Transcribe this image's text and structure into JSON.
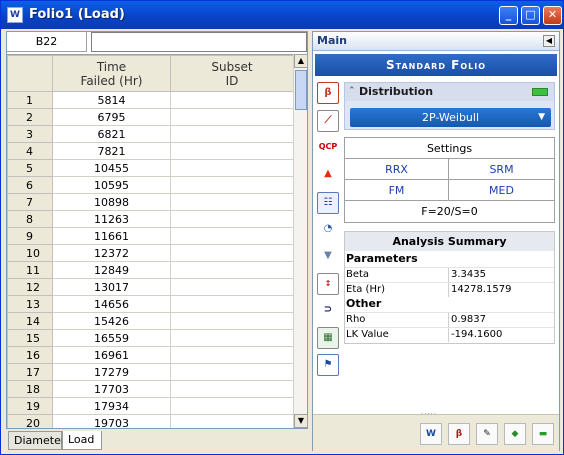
{
  "window": {
    "title": "Folio1 (Load)",
    "minimize": "_",
    "maximize": "□",
    "close": "✕"
  },
  "grid": {
    "cell_ref": "B22",
    "formula_value": "",
    "columns": [
      "Time\nFailed (Hr)",
      "Subset\nID"
    ],
    "col1_line1": "Time",
    "col1_line2": "Failed (Hr)",
    "col2_line1": "Subset",
    "col2_line2": "ID",
    "rows": [
      {
        "n": "1",
        "time": "5814",
        "subset": ""
      },
      {
        "n": "2",
        "time": "6795",
        "subset": ""
      },
      {
        "n": "3",
        "time": "6821",
        "subset": ""
      },
      {
        "n": "4",
        "time": "7821",
        "subset": ""
      },
      {
        "n": "5",
        "time": "10455",
        "subset": ""
      },
      {
        "n": "6",
        "time": "10595",
        "subset": ""
      },
      {
        "n": "7",
        "time": "10898",
        "subset": ""
      },
      {
        "n": "8",
        "time": "11263",
        "subset": ""
      },
      {
        "n": "9",
        "time": "11661",
        "subset": ""
      },
      {
        "n": "10",
        "time": "12372",
        "subset": ""
      },
      {
        "n": "11",
        "time": "12849",
        "subset": ""
      },
      {
        "n": "12",
        "time": "13017",
        "subset": ""
      },
      {
        "n": "13",
        "time": "14656",
        "subset": ""
      },
      {
        "n": "14",
        "time": "15426",
        "subset": ""
      },
      {
        "n": "15",
        "time": "16559",
        "subset": ""
      },
      {
        "n": "16",
        "time": "16961",
        "subset": ""
      },
      {
        "n": "17",
        "time": "17279",
        "subset": ""
      },
      {
        "n": "18",
        "time": "17703",
        "subset": ""
      },
      {
        "n": "19",
        "time": "17934",
        "subset": ""
      },
      {
        "n": "20",
        "time": "19703",
        "subset": ""
      }
    ]
  },
  "sheet_tabs": [
    "Diameter",
    "Load"
  ],
  "panel": {
    "header": "Main",
    "banner": "Standard Folio",
    "distribution_label": "Distribution",
    "distribution_value": "2P-Weibull",
    "settings_title": "Settings",
    "settings": [
      "RRX",
      "SRM",
      "FM",
      "MED"
    ],
    "censoring": "F=20/S=0",
    "summary_title": "Analysis Summary",
    "parameters_label": "Parameters",
    "beta_label": "Beta",
    "beta_value": "3.3435",
    "eta_label": "Eta (Hr)",
    "eta_value": "14278.1579",
    "other_label": "Other",
    "rho_label": "Rho",
    "rho_value": "0.9837",
    "lk_label": "LK Value",
    "lk_value": "-194.1600"
  },
  "icons": [
    "prob-plot-icon",
    "line-plot-icon",
    "qcp-icon",
    "warning-icon",
    "list-icon",
    "gauge-icon",
    "filter-icon",
    "sort-icon",
    "magnet-icon",
    "report-icon",
    "runner-icon"
  ],
  "colors": {
    "banner": "#1b4ea6",
    "accent": "#1a3fb0",
    "titlebar": "#0842c4"
  }
}
